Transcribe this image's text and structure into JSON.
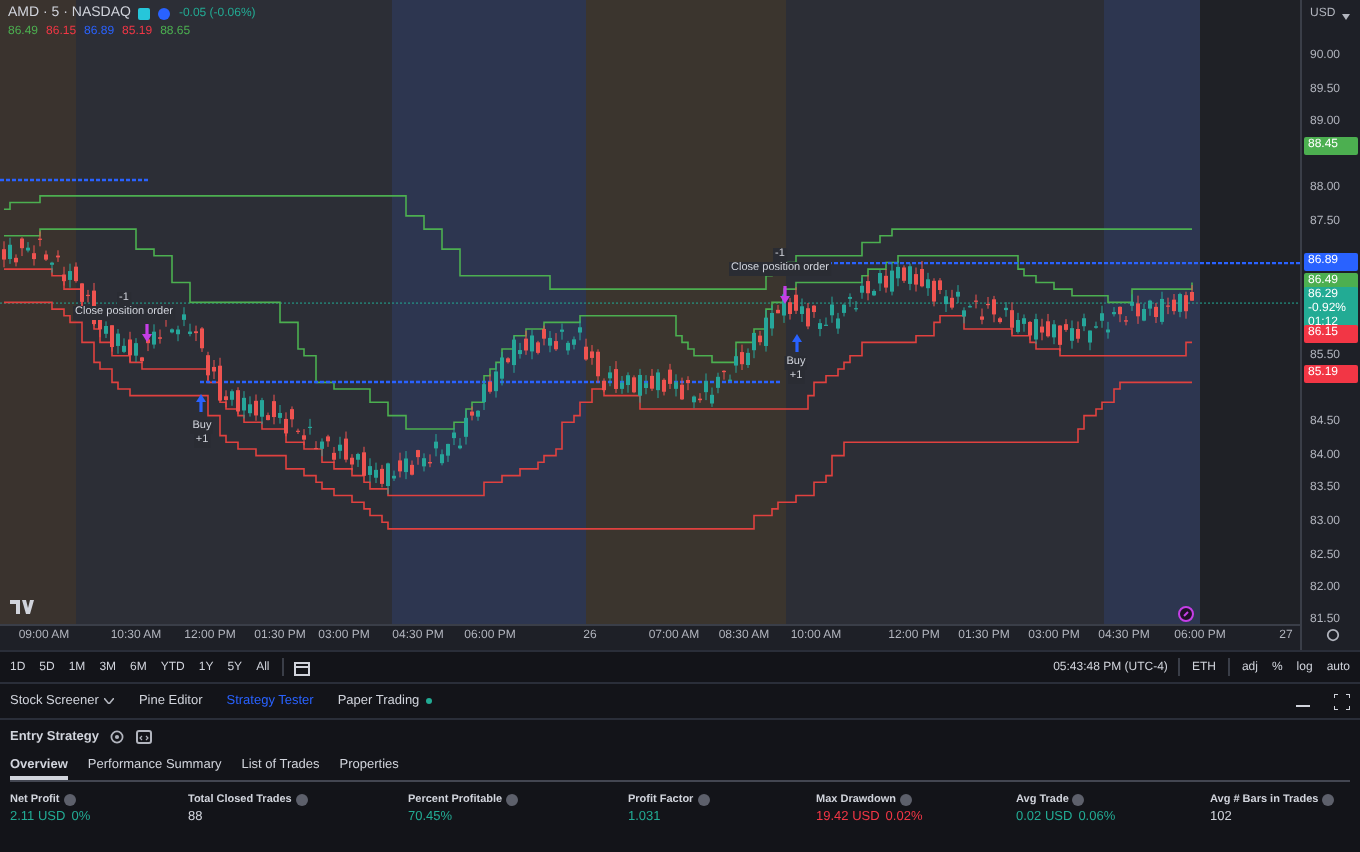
{
  "header": {
    "symbol": "AMD · 5 · NASDAQ",
    "change": "-0.05 (-0.06%)",
    "values": [
      {
        "text": "86.49",
        "color": "#4caf50"
      },
      {
        "text": "86.15",
        "color": "#f23645"
      },
      {
        "text": "86.89",
        "color": "#2962ff"
      },
      {
        "text": "85.19",
        "color": "#f23645"
      },
      {
        "text": "88.65",
        "color": "#4caf50"
      }
    ]
  },
  "annotations": [
    {
      "kind": "close",
      "lines": [
        "-1",
        "Close position order"
      ]
    },
    {
      "kind": "buy",
      "lines": [
        "Buy",
        "+1"
      ]
    },
    {
      "kind": "close",
      "lines": [
        "-1",
        "Close position order"
      ]
    },
    {
      "kind": "buy",
      "lines": [
        "Buy",
        "+1"
      ]
    }
  ],
  "price_axis": {
    "currency": "USD",
    "ticks": [
      "90.00",
      "89.50",
      "89.00",
      "88.00",
      "87.50",
      "85.50",
      "84.50",
      "84.00",
      "83.50",
      "83.00",
      "82.50",
      "82.00",
      "81.50"
    ],
    "badges": [
      {
        "lines": [
          "88.45"
        ],
        "color": "#4caf50"
      },
      {
        "lines": [
          "86.89"
        ],
        "color": "#2962ff"
      },
      {
        "lines": [
          "86.49"
        ],
        "color": "#4caf50"
      },
      {
        "lines": [
          "86.29",
          "-0.92%",
          "01:12"
        ],
        "color": "#22ab94"
      },
      {
        "lines": [
          "86.15"
        ],
        "color": "#f23645"
      },
      {
        "lines": [
          "85.19"
        ],
        "color": "#f23645"
      }
    ]
  },
  "time_axis": [
    "09:00 AM",
    "10:30 AM",
    "12:00 PM",
    "01:30 PM",
    "03:00 PM",
    "04:30 PM",
    "06:00 PM",
    "26",
    "07:00 AM",
    "08:30 AM",
    "10:00 AM",
    "12:00 PM",
    "01:30 PM",
    "03:00 PM",
    "04:30 PM",
    "06:00 PM",
    "27"
  ],
  "toolbar": {
    "ranges": [
      "1D",
      "5D",
      "1M",
      "3M",
      "6M",
      "YTD",
      "1Y",
      "5Y",
      "All"
    ],
    "clock": "05:43:48 PM (UTC-4)",
    "session": "ETH",
    "options": [
      "adj",
      "%",
      "log",
      "auto"
    ]
  },
  "bottom_tabs": [
    {
      "label": "Stock Screener",
      "selected": false,
      "kind": "menu"
    },
    {
      "label": "Pine Editor",
      "selected": false,
      "kind": "plain"
    },
    {
      "label": "Strategy Tester",
      "selected": true,
      "kind": "plain"
    },
    {
      "label": "Paper Trading",
      "selected": false,
      "kind": "dot"
    }
  ],
  "strategy": {
    "name": "Entry Strategy",
    "tabs": [
      {
        "label": "Overview",
        "selected": true
      },
      {
        "label": "Performance Summary",
        "selected": false
      },
      {
        "label": "List of Trades",
        "selected": false
      },
      {
        "label": "Properties",
        "selected": false
      }
    ],
    "metrics": [
      {
        "label": "Net Profit",
        "values": [
          {
            "text": "2.11 USD",
            "color": "#22ab94"
          },
          {
            "text": "0%",
            "color": "#22ab94"
          }
        ]
      },
      {
        "label": "Total Closed Trades",
        "values": [
          {
            "text": "88",
            "color": "#d1d4dc"
          }
        ]
      },
      {
        "label": "Percent Profitable",
        "values": [
          {
            "text": "70.45%",
            "color": "#22ab94"
          }
        ]
      },
      {
        "label": "Profit Factor",
        "values": [
          {
            "text": "1.031",
            "color": "#22ab94"
          }
        ]
      },
      {
        "label": "Max Drawdown",
        "values": [
          {
            "text": "19.42 USD",
            "color": "#f23645"
          },
          {
            "text": "0.02%",
            "color": "#f23645"
          }
        ]
      },
      {
        "label": "Avg Trade",
        "values": [
          {
            "text": "0.02 USD",
            "color": "#22ab94"
          },
          {
            "text": "0.06%",
            "color": "#22ab94"
          }
        ]
      },
      {
        "label": "Avg # Bars in Trades",
        "values": [
          {
            "text": "102",
            "color": "#d1d4dc"
          }
        ]
      }
    ]
  }
}
